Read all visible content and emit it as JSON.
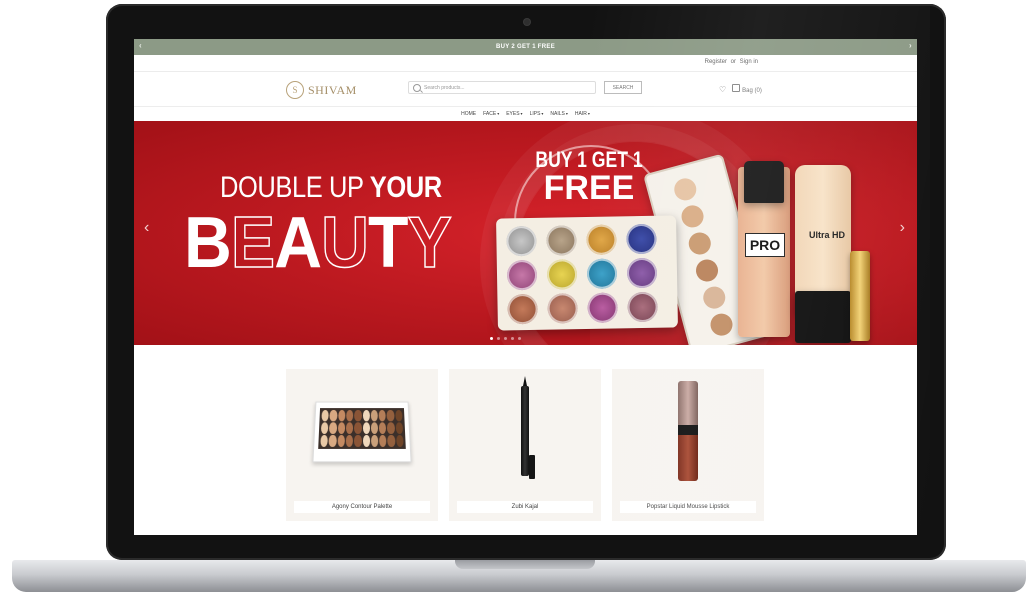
{
  "announcement": {
    "text": "BUY 2 GET 1 FREE",
    "prev_arrow": "‹",
    "next_arrow": "›"
  },
  "auth": {
    "register": "Register",
    "separator": "or",
    "signin": "Sign in"
  },
  "header": {
    "logo_mark": "S",
    "logo_text": "SHIVAM",
    "search_placeholder": "Search products...",
    "search_button": "SEARCH",
    "bag_label": "Bag (0)"
  },
  "nav": [
    {
      "label": "HOME",
      "has_caret": false
    },
    {
      "label": "FACE",
      "has_caret": true
    },
    {
      "label": "EYES",
      "has_caret": true
    },
    {
      "label": "LIPS",
      "has_caret": true
    },
    {
      "label": "NAILS",
      "has_caret": true
    },
    {
      "label": "HAIR",
      "has_caret": true
    }
  ],
  "banner": {
    "headline_light": "DOUBLE UP ",
    "headline_bold": "YOUR",
    "headline_big": [
      "B",
      "E",
      "A",
      "U",
      "T",
      "Y"
    ],
    "promo_line1": "BUY 1 GET 1",
    "promo_line2": "FREE",
    "pro_label": "PRO",
    "ultra_label": "Ultra HD",
    "prev_arrow": "‹",
    "next_arrow": "›",
    "slide_count": 5,
    "active_slide": 1
  },
  "products": [
    {
      "name": "Agony Contour Palette"
    },
    {
      "name": "Zubi Kajal"
    },
    {
      "name": "Popstar Liquid Mousse Lipstick"
    }
  ],
  "colors": {
    "announcement_bg": "#8c9a86",
    "banner_red": "#c01b22",
    "logo_gold": "#a58f68",
    "card_bg": "#f7f4f0"
  }
}
